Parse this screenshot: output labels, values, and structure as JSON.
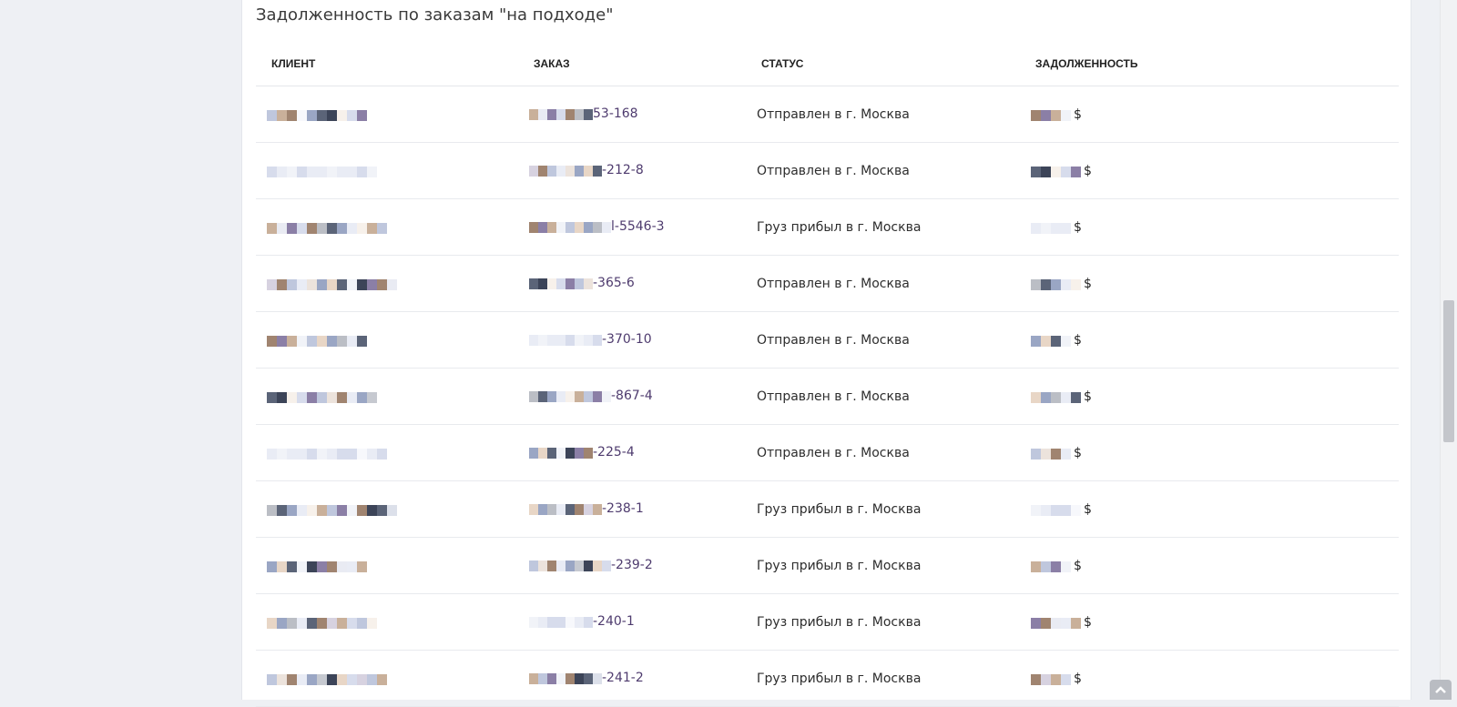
{
  "title": "Задолженность по заказам \"на подходе\"",
  "columns": {
    "client": "КЛИЕНТ",
    "order": "ЗАКАЗ",
    "status": "СТАТУС",
    "debt": "ЗАДОЛЖЕННОСТЬ"
  },
  "currency_symbol": "$",
  "rows": [
    {
      "order_suffix": "53-168",
      "status": "Отправлен в г. Москва"
    },
    {
      "order_suffix": "-212-8",
      "status": "Отправлен в г. Москва"
    },
    {
      "order_suffix": "l-5546-3",
      "status": "Груз прибыл в г. Москва"
    },
    {
      "order_suffix": "-365-6",
      "status": "Отправлен в г. Москва"
    },
    {
      "order_suffix": "-370-10",
      "status": "Отправлен в г. Москва"
    },
    {
      "order_suffix": "-867-4",
      "status": "Отправлен в г. Москва"
    },
    {
      "order_suffix": "-225-4",
      "status": "Отправлен в г. Москва"
    },
    {
      "order_suffix": "-238-1",
      "status": "Груз прибыл в г. Москва"
    },
    {
      "order_suffix": "-239-2",
      "status": "Груз прибыл в г. Москва"
    },
    {
      "order_suffix": "-240-1",
      "status": "Груз прибыл в г. Москва"
    },
    {
      "order_suffix": "-241-2",
      "status": "Груз прибыл в г. Москва"
    }
  ],
  "mosaic_palette": [
    "#e8d6c6",
    "#c9b09a",
    "#5b6478",
    "#9aa6c4",
    "#d7dcec",
    "#a08470",
    "#3c4458",
    "#bfc7dd",
    "#8b7fa6",
    "#e9ecf5"
  ],
  "icons": {
    "scroll_to_top": "chevron-up-icon"
  }
}
